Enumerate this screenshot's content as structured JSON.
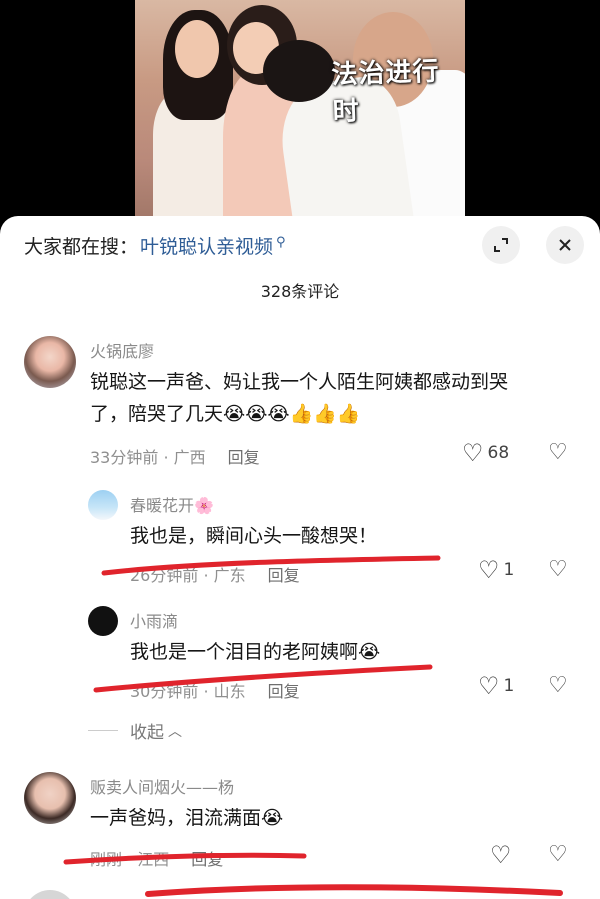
{
  "video": {
    "watermark": "法治进行时"
  },
  "sheet": {
    "search_prefix": "大家都在搜：",
    "search_link": "叶锐聪认亲视频",
    "comment_count": "328条评论",
    "collapse_label": "收起"
  },
  "comments": [
    {
      "user": "火锅底廖",
      "text_line1": "锐聪这一声爸、妈让我一个人陌生阿姨都感动到哭",
      "text_line2": "了，陪哭了几天",
      "emojis": "😭😭😭👍👍👍",
      "time": "33分钟前 · 广西",
      "reply": "回复",
      "likes": "68"
    },
    {
      "user": "春暖花开",
      "user_emoji": "🌸",
      "text": "我也是，瞬间心头一酸想哭！",
      "time": "26分钟前 · 广东",
      "reply": "回复",
      "likes": "1"
    },
    {
      "user": "小雨滴",
      "text": "我也是一个泪目的老阿姨啊",
      "emojis": "😭",
      "time": "30分钟前 · 山东",
      "reply": "回复",
      "likes": "1"
    },
    {
      "user": "贩卖人间烟火——杨",
      "text": "一声爸妈，泪流满面",
      "emojis": "😭",
      "time": "刚刚 · 江西",
      "reply": "回复",
      "likes": ""
    }
  ],
  "icons": {
    "search": "search-icon",
    "expand": "expand-icon",
    "close": "close-icon",
    "like": "heart-icon",
    "dislike": "broken-heart-icon"
  },
  "colors": {
    "link": "#2f5d96",
    "annotation": "#e0242c"
  }
}
